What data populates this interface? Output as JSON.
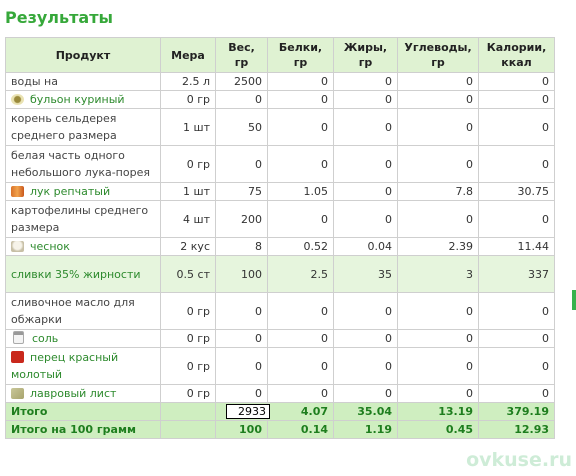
{
  "title": "Результаты",
  "headers": [
    "Продукт",
    "Мера",
    "Вес, гр",
    "Белки, гр",
    "Жиры, гр",
    "Углеводы, гр",
    "Калории, ккал"
  ],
  "rows": [
    {
      "product": "воды на",
      "link": false,
      "icon": "",
      "measure": "2.5 л",
      "weight": "2500",
      "protein": "0",
      "fat": "0",
      "carbs": "0",
      "kcal": "0",
      "tall": false,
      "hl": false
    },
    {
      "product": "бульон куриный",
      "link": true,
      "icon": "broth",
      "measure": "0 гр",
      "weight": "0",
      "protein": "0",
      "fat": "0",
      "carbs": "0",
      "kcal": "0",
      "tall": false,
      "hl": false
    },
    {
      "product": "корень сельдерея среднего размера",
      "link": false,
      "icon": "",
      "measure": "1 шт",
      "weight": "50",
      "protein": "0",
      "fat": "0",
      "carbs": "0",
      "kcal": "0",
      "tall": true,
      "hl": false
    },
    {
      "product": "белая часть одного небольшого лука-порея",
      "link": false,
      "icon": "",
      "measure": "0 гр",
      "weight": "0",
      "protein": "0",
      "fat": "0",
      "carbs": "0",
      "kcal": "0",
      "tall": true,
      "hl": false
    },
    {
      "product": "лук репчатый",
      "link": true,
      "icon": "onion",
      "measure": "1 шт",
      "weight": "75",
      "protein": "1.05",
      "fat": "0",
      "carbs": "7.8",
      "kcal": "30.75",
      "tall": false,
      "hl": false
    },
    {
      "product": "картофелины среднего размера",
      "link": false,
      "icon": "",
      "measure": "4 шт",
      "weight": "200",
      "protein": "0",
      "fat": "0",
      "carbs": "0",
      "kcal": "0",
      "tall": true,
      "hl": false
    },
    {
      "product": "чеснок",
      "link": true,
      "icon": "garlic",
      "measure": "2 кус",
      "weight": "8",
      "protein": "0.52",
      "fat": "0.04",
      "carbs": "2.39",
      "kcal": "11.44",
      "tall": false,
      "hl": false
    },
    {
      "product": "сливки 35% жирности",
      "link": true,
      "icon": "",
      "measure": "0.5 ст",
      "weight": "100",
      "protein": "2.5",
      "fat": "35",
      "carbs": "3",
      "kcal": "337",
      "tall": true,
      "hl": true
    },
    {
      "product": "сливочное масло для обжарки",
      "link": false,
      "icon": "",
      "measure": "0 гр",
      "weight": "0",
      "protein": "0",
      "fat": "0",
      "carbs": "0",
      "kcal": "0",
      "tall": true,
      "hl": false
    },
    {
      "product": "соль",
      "link": true,
      "icon": "salt",
      "measure": "0 гр",
      "weight": "0",
      "protein": "0",
      "fat": "0",
      "carbs": "0",
      "kcal": "0",
      "tall": false,
      "hl": false
    },
    {
      "product": "перец красный молотый",
      "link": true,
      "icon": "pepper",
      "measure": "0 гр",
      "weight": "0",
      "protein": "0",
      "fat": "0",
      "carbs": "0",
      "kcal": "0",
      "tall": true,
      "hl": false
    },
    {
      "product": "лавровый лист",
      "link": true,
      "icon": "bay",
      "measure": "0 гр",
      "weight": "0",
      "protein": "0",
      "fat": "0",
      "carbs": "0",
      "kcal": "0",
      "tall": false,
      "hl": false
    }
  ],
  "totals": {
    "label": "Итого",
    "weight": "2933",
    "protein": "4.07",
    "fat": "35.04",
    "carbs": "13.19",
    "kcal": "379.19"
  },
  "per100": {
    "label": "Итого на 100 грамм",
    "weight": "100",
    "protein": "0.14",
    "fat": "1.19",
    "carbs": "0.45",
    "kcal": "12.93"
  },
  "watermark": "ovkuse.ru"
}
